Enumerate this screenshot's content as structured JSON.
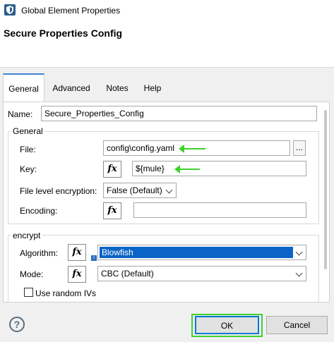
{
  "window": {
    "title": "Global Element Properties"
  },
  "header": {
    "title": "Secure Properties Config"
  },
  "tabs": [
    {
      "label": "General",
      "active": true
    },
    {
      "label": "Advanced",
      "active": false
    },
    {
      "label": "Notes",
      "active": false
    },
    {
      "label": "Help",
      "active": false
    }
  ],
  "form": {
    "name_label": "Name:",
    "name_value": "Secure_Properties_Config",
    "general_group": {
      "title": "General",
      "file_label": "File:",
      "file_value": "config\\config.yaml",
      "browse_label": "...",
      "key_label": "Key:",
      "key_value": "${mule}",
      "file_encryption_label": "File level encryption:",
      "file_encryption_value": "False (Default)",
      "encoding_label": "Encoding:",
      "encoding_value": ""
    },
    "encrypt_group": {
      "title": "encrypt",
      "algorithm_label": "Algorithm:",
      "algorithm_value": "Blowfish",
      "mode_label": "Mode:",
      "mode_value": "CBC (Default)",
      "random_ivs_label": "Use random IVs",
      "random_ivs_checked": false
    },
    "fx_label": "fx"
  },
  "footer": {
    "ok_label": "OK",
    "cancel_label": "Cancel",
    "help_label": "?"
  },
  "colors": {
    "highlight": "#3fd12c",
    "selection": "#0a64c8",
    "active_tab_border": "#3c83d4"
  }
}
